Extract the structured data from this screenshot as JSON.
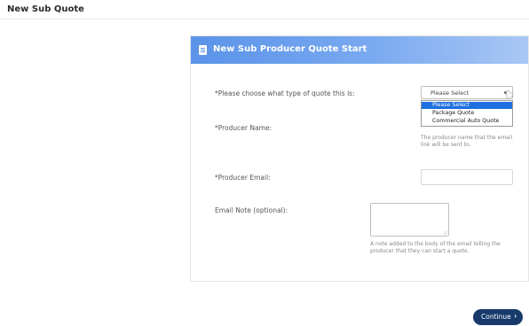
{
  "page": {
    "title": "New Sub Quote"
  },
  "card": {
    "title": "New Sub Producer Quote Start",
    "icon": "document-icon"
  },
  "form": {
    "quote_type": {
      "label": "*Please choose what type of quote this is:",
      "selected": "Please Select",
      "options": [
        "Please Select",
        "Package Quote",
        "Commercial Auto Quote"
      ]
    },
    "producer_name": {
      "label": "*Producer Name:",
      "value": "",
      "hint": "The producer name that the email link will be sent to."
    },
    "producer_email": {
      "label": "*Producer Email:",
      "value": ""
    },
    "email_note": {
      "label": "Email Note (optional):",
      "value": "",
      "hint": "A note added to the body of the email telling the producer that they can start a quote."
    }
  },
  "actions": {
    "continue_label": "Continue",
    "continue_icon": "chevron-right-icon"
  },
  "colors": {
    "header_start": "#5b93e9",
    "header_end": "#a9c7f4",
    "button": "#173a6b",
    "selected_option": "#1e6fe0"
  }
}
